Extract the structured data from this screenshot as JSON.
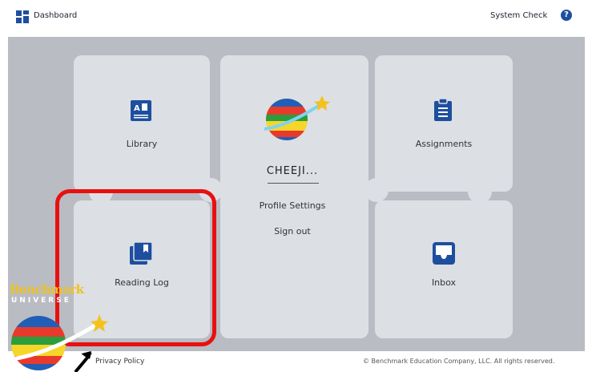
{
  "header": {
    "title": "Dashboard",
    "system_check": "System Check",
    "help": "?"
  },
  "tiles": {
    "library": {
      "label": "Library",
      "icon": "book-icon"
    },
    "assignments": {
      "label": "Assignments",
      "icon": "clipboard-icon"
    },
    "reading_log": {
      "label": "Reading Log",
      "icon": "books-icon"
    },
    "inbox": {
      "label": "Inbox",
      "icon": "inbox-icon"
    }
  },
  "profile": {
    "name": "CHEEJI...",
    "settings_label": "Profile Settings",
    "signout_label": "Sign out",
    "avatar": "planet-avatar"
  },
  "footer": {
    "privacy": "Privacy Policy",
    "copyright": "© Benchmark Education Company, LLC. All rights reserved."
  },
  "logo": {
    "line1": "Benchmark",
    "line2": "UNIVERSE"
  },
  "colors": {
    "brand_blue": "#1e4f9f",
    "highlight_red": "#e81010",
    "tile_bg": "#dcdfe4",
    "canvas_bg": "#b9bcc3"
  }
}
